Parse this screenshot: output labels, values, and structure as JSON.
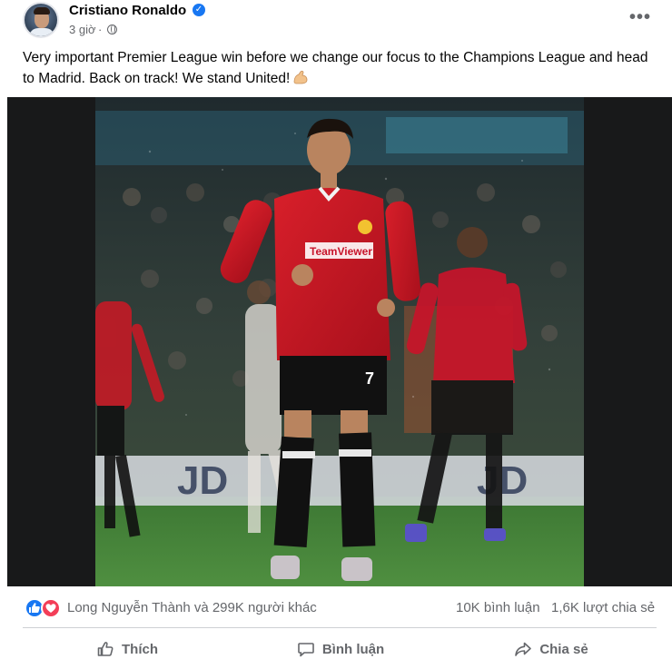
{
  "post": {
    "author": "Cristiano Ronaldo",
    "verified_mark": "✓",
    "time": "3 giờ",
    "separator": "·",
    "privacy_icon": "globe-icon",
    "more_icon": "more-icon",
    "more_label": "•••",
    "caption": "Very important Premier League win before we change our focus to the Champions League and head to Madrid. Back on track! We stand United!",
    "caption_emoji_icon": "flexed-biceps-icon"
  },
  "media": {
    "description_icon": "football-player-photo"
  },
  "reactions": {
    "icons": [
      "like-icon",
      "love-icon"
    ],
    "summary": "Long Nguyễn Thành và 299K người khác",
    "comments": "10K bình luận",
    "shares": "1,6K lượt chia sẻ"
  },
  "actions": {
    "like_label": "Thích",
    "comment_label": "Bình luận",
    "share_label": "Chia sẻ"
  },
  "colors": {
    "facebook_blue": "#1877f2",
    "love_red": "#f33e58",
    "secondary_text": "#65676b",
    "jersey_red": "#c8102e"
  }
}
